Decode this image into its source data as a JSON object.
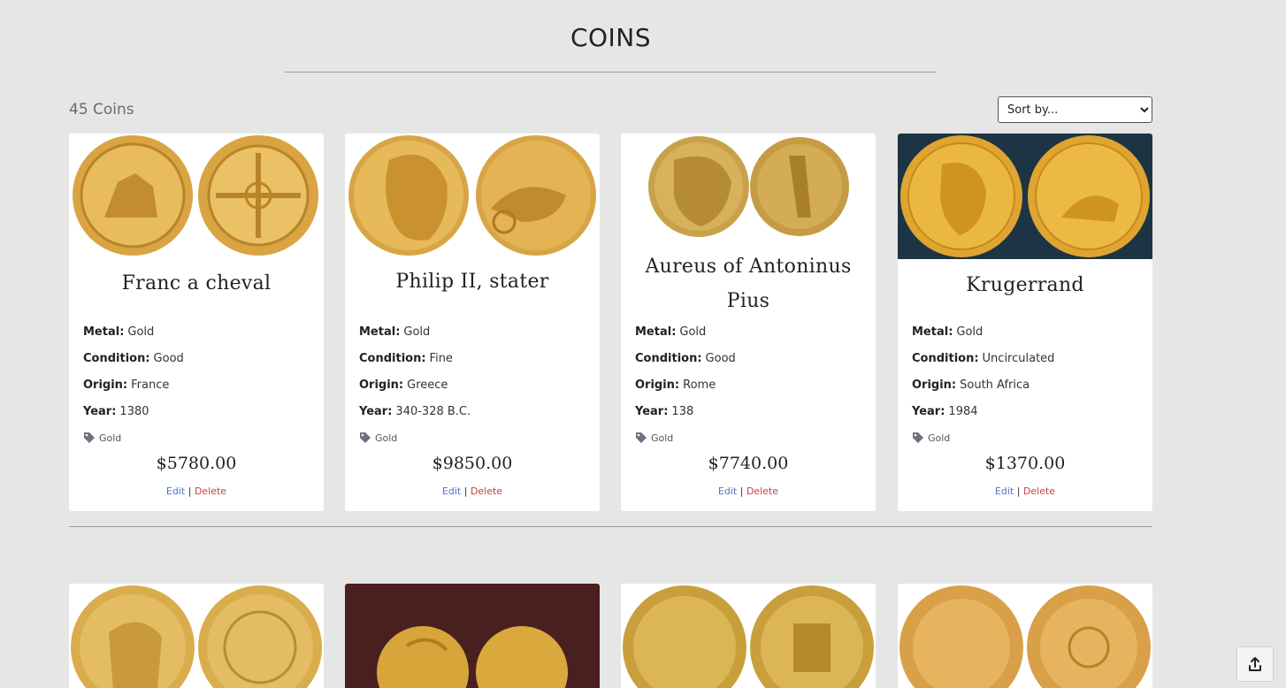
{
  "page": {
    "title": "COINS"
  },
  "toolbar": {
    "count_label": "45 Coins",
    "sort_placeholder": "Sort by..."
  },
  "labels": {
    "metal": "Metal:",
    "condition": "Condition:",
    "origin": "Origin:",
    "year": "Year:",
    "edit": "Edit",
    "separator": "|",
    "delete": "Delete"
  },
  "coins": [
    {
      "name": "Franc a cheval",
      "metal": "Gold",
      "condition": "Good",
      "origin": "France",
      "year": "1380",
      "tag": "Gold",
      "price": "$5780.00"
    },
    {
      "name": "Philip II, stater",
      "metal": "Gold",
      "condition": "Fine",
      "origin": "Greece",
      "year": "340-328 B.C.",
      "tag": "Gold",
      "price": "$9850.00"
    },
    {
      "name": "Aureus of Antoninus Pius",
      "metal": "Gold",
      "condition": "Good",
      "origin": "Rome",
      "year": "138",
      "tag": "Gold",
      "price": "$7740.00"
    },
    {
      "name": "Krugerrand",
      "metal": "Gold",
      "condition": "Uncirculated",
      "origin": "South Africa",
      "year": "1984",
      "tag": "Gold",
      "price": "$1370.00"
    }
  ],
  "colors": {
    "background": "#e6e6e6",
    "card": "#ffffff",
    "gold": "#e0b04a",
    "edit": "#4a76c9",
    "delete": "#cc3f3f"
  },
  "icons": {
    "tag": "tag-icon",
    "scroll_top": "upload-arrow-icon"
  }
}
